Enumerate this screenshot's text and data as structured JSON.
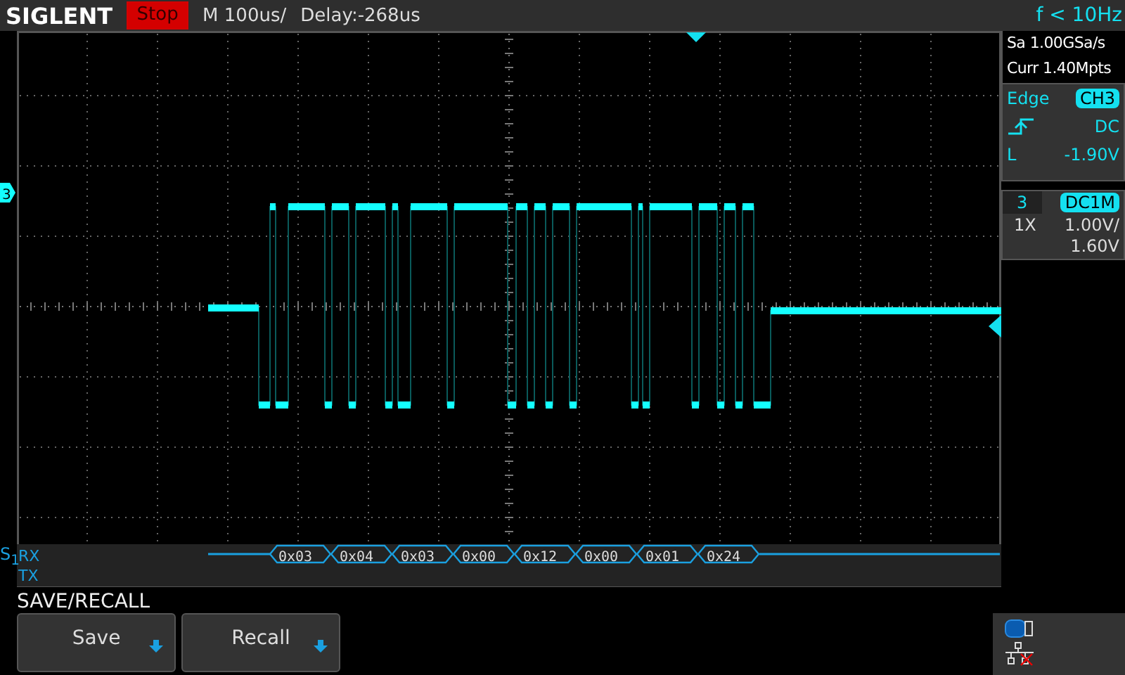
{
  "header": {
    "brand": "SIGLENT",
    "run_state": "Stop",
    "timebase": "M 100us/",
    "delay": "Delay:-268us",
    "frequency": "f < 10Hz"
  },
  "channel_marker": "3",
  "acquisition": {
    "sample_rate": "Sa 1.00GSa/s",
    "memory": "Curr 1.40Mpts"
  },
  "trigger": {
    "type": "Edge",
    "source": "CH3",
    "coupling": "DC",
    "level_label": "L",
    "level_value": "-1.90V"
  },
  "channel": {
    "number": "3",
    "coupling": "DC1M",
    "probe": "1X",
    "scale": "1.00V/",
    "offset": "1.60V"
  },
  "decode": {
    "bus": "S$_{1}$",
    "lines": [
      "RX",
      "TX"
    ],
    "frames": [
      "0x03",
      "0x04",
      "0x03",
      "0x00",
      "0x12",
      "0x00",
      "0x01",
      "0x24"
    ]
  },
  "menu": {
    "title": "SAVE/RECALL",
    "buttons": [
      {
        "label": "Save"
      },
      {
        "label": "Recall"
      }
    ]
  }
}
